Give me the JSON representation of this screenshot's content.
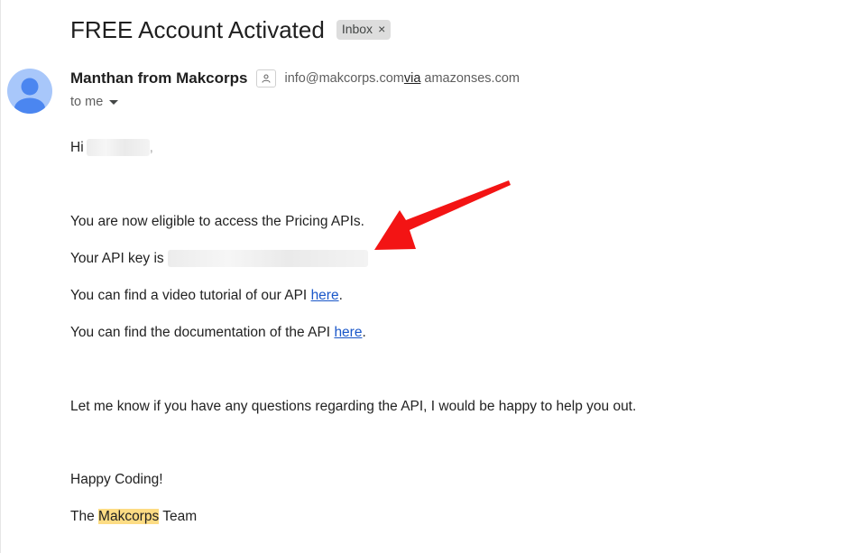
{
  "email": {
    "subject": "FREE Account Activated",
    "label": "Inbox",
    "label_remove": "×",
    "sender_name": "Manthan from Makcorps",
    "sender_email": "info@makcorps.com",
    "via_word": "via",
    "via_domain": "amazonses.com",
    "recipient": "to me"
  },
  "body": {
    "greeting": "Hi",
    "greeting_punct": ",",
    "line1": "You are now eligible to access the Pricing APIs.",
    "line2": "Your API key is",
    "line3": "You can find a video tutorial of our API",
    "line3_link": "here",
    "line3_end": ".",
    "line4": "You can find the documentation of the API",
    "line4_link": "here",
    "line4_end": ".",
    "line5": "Let me know if you have any questions regarding the API, I would be happy to help you out.",
    "line6": "Happy Coding!",
    "sign_pre": "The",
    "sign_highlight": "Makcorps",
    "sign_post": "Team"
  },
  "icons": {
    "avatar": "person-icon",
    "contact": "contact-card-icon",
    "dropdown": "chevron-down-icon",
    "annotation": "red-arrow-icon"
  },
  "colors": {
    "annotation_arrow": "#f31414",
    "link": "#1a57c9",
    "highlight": "#fddc84",
    "avatar_bg": "#a8c7fa",
    "avatar_fg": "#4b86f0"
  }
}
